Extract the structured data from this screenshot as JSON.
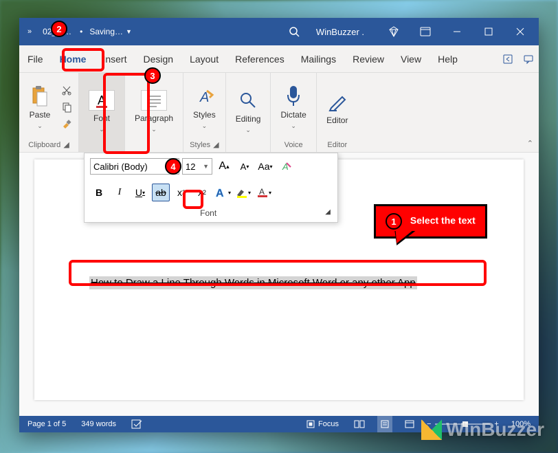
{
  "titlebar": {
    "chevron": "»",
    "doc_name": "02_Mic…",
    "saving_label": "Saving…",
    "brand": "WinBuzzer ."
  },
  "tabs": {
    "file": "File",
    "home": "Home",
    "insert": "Insert",
    "design": "Design",
    "layout": "Layout",
    "references": "References",
    "mailings": "Mailings",
    "review": "Review",
    "view": "View",
    "help": "Help"
  },
  "ribbon": {
    "clipboard": {
      "paste": "Paste",
      "label": "Clipboard"
    },
    "font": {
      "btn": "Font",
      "label": "Font"
    },
    "paragraph": {
      "btn": "Paragraph",
      "label": ""
    },
    "styles": {
      "btn": "Styles",
      "label": "Styles"
    },
    "editing": {
      "btn": "Editing",
      "label": ""
    },
    "voice": {
      "btn": "Dictate",
      "label": "Voice"
    },
    "editor": {
      "btn": "Editor",
      "label": "Editor"
    }
  },
  "flyout": {
    "font_name": "Calibri (Body)",
    "font_size": "12",
    "case_label": "Aa",
    "group_label": "Font"
  },
  "document": {
    "selected_text": "How to Draw a Line Through Words in Microsoft Word or any other App"
  },
  "statusbar": {
    "page": "Page 1 of 5",
    "words": "349 words",
    "focus": "Focus",
    "zoom": "100%"
  },
  "annotations": {
    "n1": "1",
    "n2": "2",
    "n3": "3",
    "n4": "4",
    "callout1": "Select the text"
  },
  "watermark": "WinBuzzer"
}
